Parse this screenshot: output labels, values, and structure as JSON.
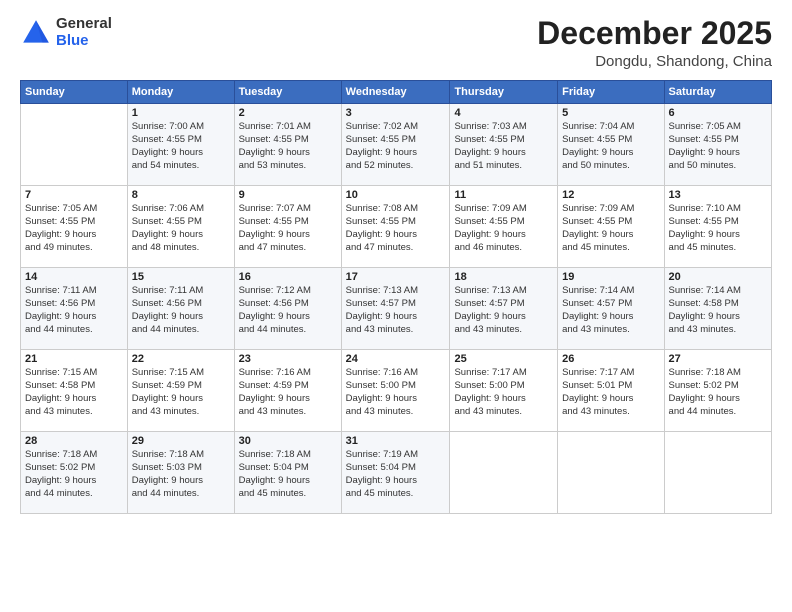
{
  "logo": {
    "general": "General",
    "blue": "Blue"
  },
  "header": {
    "month": "December 2025",
    "location": "Dongdu, Shandong, China"
  },
  "days_of_week": [
    "Sunday",
    "Monday",
    "Tuesday",
    "Wednesday",
    "Thursday",
    "Friday",
    "Saturday"
  ],
  "weeks": [
    [
      {
        "day": "",
        "info": ""
      },
      {
        "day": "1",
        "info": "Sunrise: 7:00 AM\nSunset: 4:55 PM\nDaylight: 9 hours\nand 54 minutes."
      },
      {
        "day": "2",
        "info": "Sunrise: 7:01 AM\nSunset: 4:55 PM\nDaylight: 9 hours\nand 53 minutes."
      },
      {
        "day": "3",
        "info": "Sunrise: 7:02 AM\nSunset: 4:55 PM\nDaylight: 9 hours\nand 52 minutes."
      },
      {
        "day": "4",
        "info": "Sunrise: 7:03 AM\nSunset: 4:55 PM\nDaylight: 9 hours\nand 51 minutes."
      },
      {
        "day": "5",
        "info": "Sunrise: 7:04 AM\nSunset: 4:55 PM\nDaylight: 9 hours\nand 50 minutes."
      },
      {
        "day": "6",
        "info": "Sunrise: 7:05 AM\nSunset: 4:55 PM\nDaylight: 9 hours\nand 50 minutes."
      }
    ],
    [
      {
        "day": "7",
        "info": "Sunrise: 7:05 AM\nSunset: 4:55 PM\nDaylight: 9 hours\nand 49 minutes."
      },
      {
        "day": "8",
        "info": "Sunrise: 7:06 AM\nSunset: 4:55 PM\nDaylight: 9 hours\nand 48 minutes."
      },
      {
        "day": "9",
        "info": "Sunrise: 7:07 AM\nSunset: 4:55 PM\nDaylight: 9 hours\nand 47 minutes."
      },
      {
        "day": "10",
        "info": "Sunrise: 7:08 AM\nSunset: 4:55 PM\nDaylight: 9 hours\nand 47 minutes."
      },
      {
        "day": "11",
        "info": "Sunrise: 7:09 AM\nSunset: 4:55 PM\nDaylight: 9 hours\nand 46 minutes."
      },
      {
        "day": "12",
        "info": "Sunrise: 7:09 AM\nSunset: 4:55 PM\nDaylight: 9 hours\nand 45 minutes."
      },
      {
        "day": "13",
        "info": "Sunrise: 7:10 AM\nSunset: 4:55 PM\nDaylight: 9 hours\nand 45 minutes."
      }
    ],
    [
      {
        "day": "14",
        "info": "Sunrise: 7:11 AM\nSunset: 4:56 PM\nDaylight: 9 hours\nand 44 minutes."
      },
      {
        "day": "15",
        "info": "Sunrise: 7:11 AM\nSunset: 4:56 PM\nDaylight: 9 hours\nand 44 minutes."
      },
      {
        "day": "16",
        "info": "Sunrise: 7:12 AM\nSunset: 4:56 PM\nDaylight: 9 hours\nand 44 minutes."
      },
      {
        "day": "17",
        "info": "Sunrise: 7:13 AM\nSunset: 4:57 PM\nDaylight: 9 hours\nand 43 minutes."
      },
      {
        "day": "18",
        "info": "Sunrise: 7:13 AM\nSunset: 4:57 PM\nDaylight: 9 hours\nand 43 minutes."
      },
      {
        "day": "19",
        "info": "Sunrise: 7:14 AM\nSunset: 4:57 PM\nDaylight: 9 hours\nand 43 minutes."
      },
      {
        "day": "20",
        "info": "Sunrise: 7:14 AM\nSunset: 4:58 PM\nDaylight: 9 hours\nand 43 minutes."
      }
    ],
    [
      {
        "day": "21",
        "info": "Sunrise: 7:15 AM\nSunset: 4:58 PM\nDaylight: 9 hours\nand 43 minutes."
      },
      {
        "day": "22",
        "info": "Sunrise: 7:15 AM\nSunset: 4:59 PM\nDaylight: 9 hours\nand 43 minutes."
      },
      {
        "day": "23",
        "info": "Sunrise: 7:16 AM\nSunset: 4:59 PM\nDaylight: 9 hours\nand 43 minutes."
      },
      {
        "day": "24",
        "info": "Sunrise: 7:16 AM\nSunset: 5:00 PM\nDaylight: 9 hours\nand 43 minutes."
      },
      {
        "day": "25",
        "info": "Sunrise: 7:17 AM\nSunset: 5:00 PM\nDaylight: 9 hours\nand 43 minutes."
      },
      {
        "day": "26",
        "info": "Sunrise: 7:17 AM\nSunset: 5:01 PM\nDaylight: 9 hours\nand 43 minutes."
      },
      {
        "day": "27",
        "info": "Sunrise: 7:18 AM\nSunset: 5:02 PM\nDaylight: 9 hours\nand 44 minutes."
      }
    ],
    [
      {
        "day": "28",
        "info": "Sunrise: 7:18 AM\nSunset: 5:02 PM\nDaylight: 9 hours\nand 44 minutes."
      },
      {
        "day": "29",
        "info": "Sunrise: 7:18 AM\nSunset: 5:03 PM\nDaylight: 9 hours\nand 44 minutes."
      },
      {
        "day": "30",
        "info": "Sunrise: 7:18 AM\nSunset: 5:04 PM\nDaylight: 9 hours\nand 45 minutes."
      },
      {
        "day": "31",
        "info": "Sunrise: 7:19 AM\nSunset: 5:04 PM\nDaylight: 9 hours\nand 45 minutes."
      },
      {
        "day": "",
        "info": ""
      },
      {
        "day": "",
        "info": ""
      },
      {
        "day": "",
        "info": ""
      }
    ]
  ]
}
